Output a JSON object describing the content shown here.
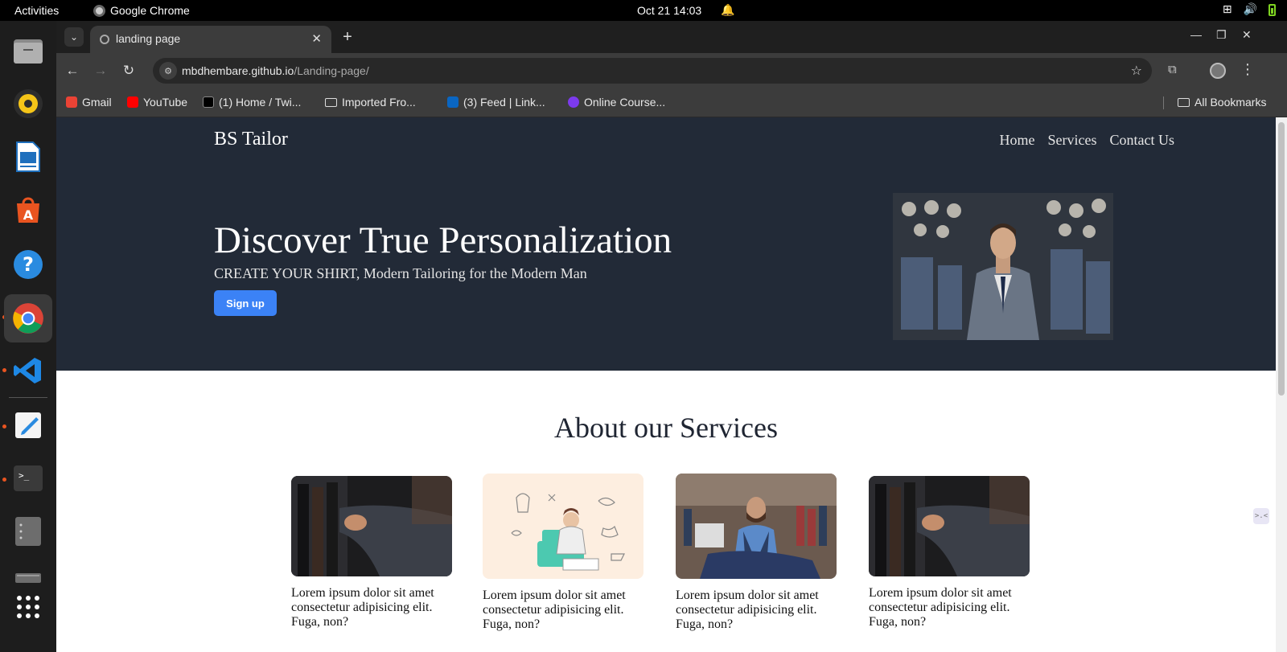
{
  "system_bar": {
    "activities": "Activities",
    "app_name": "Google Chrome",
    "clock": "Oct 21  14:03"
  },
  "dock": {
    "apps": [
      "files",
      "rhythmbox",
      "libreoffice-writer",
      "app-center",
      "help",
      "google-chrome",
      "vscode",
      "text-editor",
      "terminal",
      "file-manager",
      "drive",
      "show-apps"
    ]
  },
  "browser": {
    "tab_title": "landing page",
    "url_host": "mbdhembare.github.io",
    "url_path": "/Landing-page/",
    "bookmarks": [
      {
        "label": "Gmail",
        "icon": "gmail-icon",
        "color": "#ea4335"
      },
      {
        "label": "YouTube",
        "icon": "youtube-icon",
        "color": "#ff0000"
      },
      {
        "label": "(1) Home / Twi...",
        "icon": "x-icon",
        "color": "#000000"
      },
      {
        "label": "Imported Fro...",
        "icon": "folder-icon",
        "color": "#dddddd"
      },
      {
        "label": "(3) Feed | Link...",
        "icon": "linkedin-icon",
        "color": "#0a66c2"
      },
      {
        "label": "Online Course...",
        "icon": "course-icon",
        "color": "#7c3aed"
      }
    ],
    "all_bookmarks": "All Bookmarks"
  },
  "page": {
    "brand": "BS Tailor",
    "nav": [
      "Home",
      "Services",
      "Contact Us"
    ],
    "headline": "Discover True Personalization",
    "subhead": "CREATE YOUR SHIRT, Modern Tailoring for the Modern Man",
    "signup_label": "Sign up",
    "services_title": "About our Services",
    "cards": [
      {
        "text": "Lorem ipsum dolor sit amet consectetur adipisicing elit. Fuga, non?"
      },
      {
        "text": "Lorem ipsum dolor sit amet consectetur adipisicing elit. Fuga, non?"
      },
      {
        "text": "Lorem ipsum dolor sit amet consectetur adipisicing elit. Fuga, non?"
      },
      {
        "text": "Lorem ipsum dolor sit amet consectetur adipisicing elit. Fuga, non?"
      }
    ],
    "colors": {
      "hero_bg": "#222a37",
      "accent": "#3b82f6",
      "title": "#1f2532"
    }
  }
}
